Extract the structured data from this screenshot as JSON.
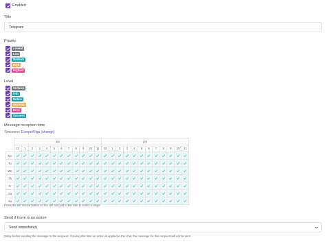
{
  "enabled": {
    "label": "Enabled",
    "checked": true
  },
  "title": {
    "label": "Title",
    "value": "Telegram"
  },
  "priority": {
    "label": "Priority",
    "items": [
      {
        "label": "Lowest",
        "checked": true,
        "color": "#6c757d"
      },
      {
        "label": "Low",
        "checked": true,
        "color": "#6c757d"
      },
      {
        "label": "Medium",
        "checked": true,
        "color": "#17a2b8"
      },
      {
        "label": "High",
        "checked": true,
        "color": "#f0ad4e"
      },
      {
        "label": "Highest",
        "checked": true,
        "color": "#e83e8c"
      }
    ]
  },
  "level": {
    "label": "Level",
    "items": [
      {
        "label": "Verbose",
        "checked": true,
        "color": "#6c757d"
      },
      {
        "label": "Info",
        "checked": true,
        "color": "#17a2b8"
      },
      {
        "label": "Notice",
        "checked": true,
        "color": "#17a2b8"
      },
      {
        "label": "Warning",
        "checked": true,
        "color": "#f0ad4e"
      },
      {
        "label": "Error",
        "checked": true,
        "color": "#e83e8c"
      },
      {
        "label": "Success",
        "checked": true,
        "color": "#17a2b8"
      }
    ]
  },
  "schedule": {
    "label": "Message reception time",
    "timezone_prefix": "Timezone:",
    "timezone_value": "Europe/Riga",
    "timezone_change": "(change)",
    "am_label": "am",
    "pm_label": "pm",
    "hours": [
      "12",
      "1",
      "2",
      "3",
      "4",
      "5",
      "6",
      "7",
      "8",
      "9",
      "10",
      "11",
      "12",
      "1",
      "2",
      "3",
      "4",
      "5",
      "6",
      "7",
      "8",
      "9",
      "10",
      "11"
    ],
    "days": [
      "Mo",
      "Tu",
      "We",
      "Th",
      "Fr",
      "Sa",
      "Su"
    ],
    "all_checked": true,
    "check_color": "#3fb8b2",
    "hint": "Press the left mouse button on the cell and pull to the side to select a range"
  },
  "no_action": {
    "label": "Send if there is no action",
    "selected": "Send immediately",
    "hint": "Delay before sending the message to the recipient. If during this time an action is applied in the chat, the message for this recipient will not be sent"
  },
  "colors": {
    "accent": "#6f42c1",
    "cell_bg": "#e9f7f7"
  }
}
